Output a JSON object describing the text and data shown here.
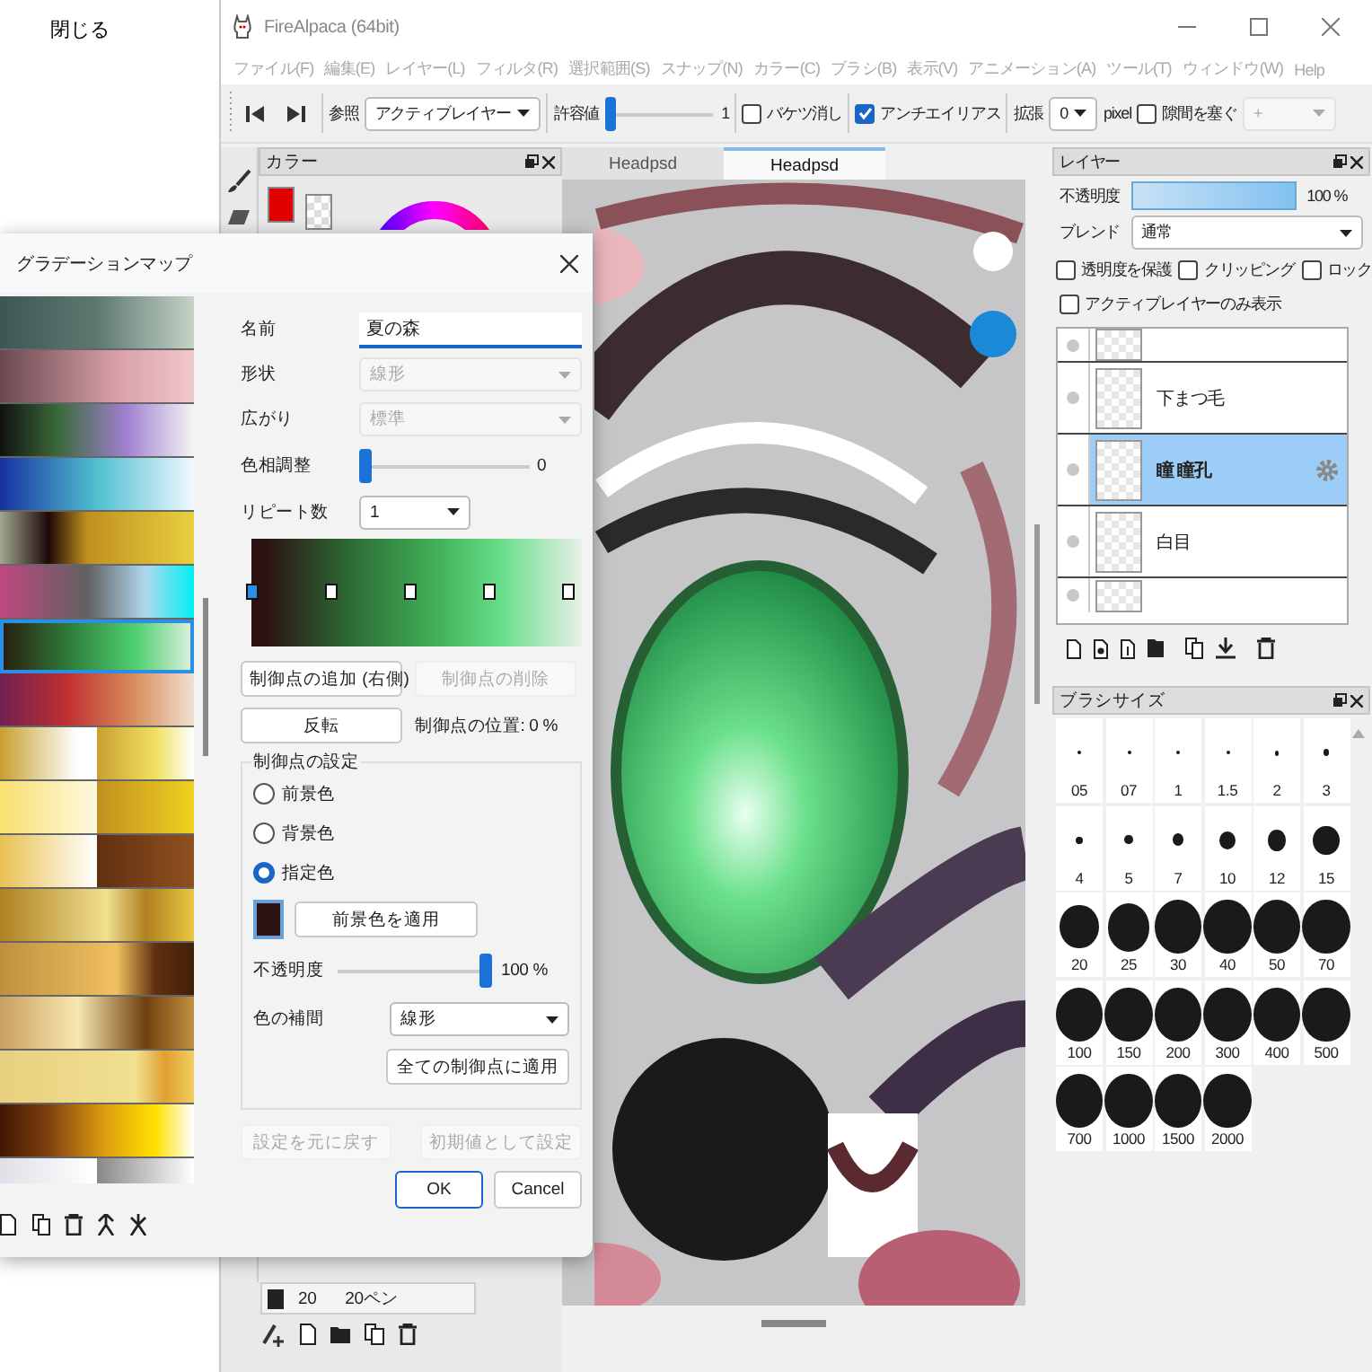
{
  "background_menu": {
    "item": "閉じる"
  },
  "window": {
    "title": "FireAlpaca (64bit)"
  },
  "menu": [
    "ファイル(F)",
    "編集(E)",
    "レイヤー(L)",
    "フィルタ(R)",
    "選択範囲(S)",
    "スナップ(N)",
    "カラー(C)",
    "ブラシ(B)",
    "表示(V)",
    "アニメーション(A)",
    "ツール(T)",
    "ウィンドウ(W)",
    "Help"
  ],
  "toolbar": {
    "reference_label": "参照",
    "reference_value": "アクティブレイヤー",
    "tolerance_label": "許容値",
    "tolerance_slider": {
      "level": 0
    },
    "tolerance_value": "1",
    "checks": [
      {
        "label": "バケツ消し",
        "checked": false
      },
      {
        "label": "アンチエイリアス",
        "checked": true
      }
    ],
    "expand_label": "拡張",
    "expand_value": "0",
    "expand_unit": "pixel",
    "gap_close": {
      "label": "隙間を塞ぐ",
      "checked": false
    },
    "gap_value": "+"
  },
  "color_panel": {
    "title": "カラー"
  },
  "tabs": [
    {
      "label": "Headpsd",
      "selected": false
    },
    {
      "label": "Headpsd",
      "selected": true
    }
  ],
  "brush_list": {
    "size": "20",
    "name": "20ペン"
  },
  "layer_panel": {
    "title": "レイヤー",
    "opacity_label": "不透明度",
    "opacity_slider": {
      "level": 1
    },
    "opacity_value": "100 %",
    "blend_label": "ブレンド",
    "blend_value": "通常",
    "options": [
      {
        "label": "透明度を保護",
        "checked": false
      },
      {
        "label": "クリッピング",
        "checked": false
      },
      {
        "label": "ロック",
        "checked": false
      },
      {
        "label": "アクティブレイヤーのみ表示",
        "checked": false
      }
    ],
    "layers": [
      {
        "name": "下まつ毛",
        "selected": false
      },
      {
        "name": "瞳  瞳孔",
        "selected": true
      },
      {
        "name": "白目",
        "selected": false
      }
    ]
  },
  "brush_panel": {
    "title": "ブラシサイズ",
    "sizes": [
      "05",
      "07",
      "1",
      "1.5",
      "2",
      "3",
      "4",
      "5",
      "7",
      "10",
      "12",
      "15",
      "20",
      "25",
      "30",
      "40",
      "50",
      "70",
      "100",
      "150",
      "200",
      "300",
      "400",
      "500",
      "700",
      "1000",
      "1500",
      "2000"
    ]
  },
  "dialog": {
    "title": "グラデーションマップ",
    "presets": [
      {
        "selected": false
      },
      {
        "selected": false
      },
      {
        "selected": false
      },
      {
        "selected": false
      },
      {
        "selected": false
      },
      {
        "selected": false
      },
      {
        "selected": true
      },
      {
        "selected": false
      },
      {
        "selected": false
      },
      {
        "selected": false
      },
      {
        "selected": false
      },
      {
        "selected": false
      },
      {
        "selected": false
      },
      {
        "selected": false
      },
      {
        "selected": false
      },
      {
        "selected": false
      },
      {
        "selected": false
      }
    ],
    "name_label": "名前",
    "name_value": "夏の森",
    "shape_label": "形状",
    "shape_value": "線形",
    "shape_disabled": true,
    "spread_label": "広がり",
    "spread_value": "標準",
    "spread_disabled": true,
    "hue_label": "色相調整",
    "hue_slider": {
      "level": 0
    },
    "hue_value": "0",
    "repeat_label": "リピート数",
    "repeat_value": "1",
    "stops": [
      {
        "selected": true
      },
      {
        "selected": false
      },
      {
        "selected": false
      },
      {
        "selected": false
      },
      {
        "selected": false
      }
    ],
    "add_button": {
      "label": "制御点の追加 (右側)",
      "disabled": false
    },
    "delete_button": {
      "label": "制御点の削除",
      "disabled": true
    },
    "reverse_button": {
      "label": "反転",
      "disabled": false
    },
    "position_text": "制御点の位置: 0 %",
    "group_label": "制御点の設定",
    "radios": [
      {
        "label": "前景色",
        "selected": false
      },
      {
        "label": "背景色",
        "selected": false
      },
      {
        "label": "指定色",
        "selected": true
      }
    ],
    "apply_fg_button": {
      "label": "前景色を適用",
      "disabled": false
    },
    "opacity_label": "不透明度",
    "opacity_slider": {
      "level": 1
    },
    "opacity_value": "100 %",
    "interp_label": "色の補間",
    "interp_value": "線形",
    "apply_all_button": {
      "label": "全ての制御点に適用",
      "disabled": false
    },
    "reset_button": {
      "label": "設定を元に戻す",
      "disabled": true
    },
    "default_button": {
      "label": "初期値として設定",
      "disabled": true
    },
    "ok_button": {
      "label": "OK",
      "disabled": false
    },
    "cancel_button": {
      "label": "Cancel",
      "disabled": false
    }
  }
}
